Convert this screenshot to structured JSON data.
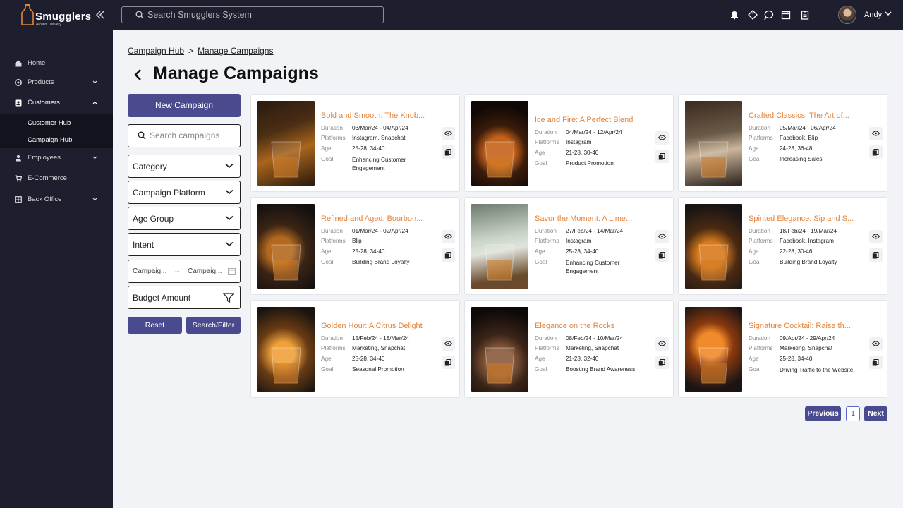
{
  "app": {
    "brand": "Smugglers",
    "brand_sub": "Alcohol Delivery",
    "search_placeholder": "Search Smugglers System",
    "user_name": "Andy"
  },
  "top_icons": [
    "bell-icon",
    "tag-icon",
    "chat-icon",
    "calendar-icon",
    "clipboard-icon"
  ],
  "sidebar": {
    "items": [
      {
        "label": "Home",
        "icon": "home-icon"
      },
      {
        "label": "Products",
        "icon": "products-icon"
      },
      {
        "label": "Customers",
        "icon": "customers-icon"
      },
      {
        "label": "Employees",
        "icon": "employees-icon"
      },
      {
        "label": "E-Commerce",
        "icon": "ecommerce-icon"
      },
      {
        "label": "Back Office",
        "icon": "back-office-icon"
      }
    ],
    "sub_items": [
      {
        "label": "Customer Hub"
      },
      {
        "label": "Campaign Hub"
      }
    ]
  },
  "breadcrumb": [
    "Campaign Hub",
    "Manage Campaigns"
  ],
  "page_title": "Manage Campaigns",
  "filters": {
    "new_campaign": "New Campaign",
    "search_placeholder": "Search campaigns",
    "category": "Category",
    "platform": "Campaign Platform",
    "age_group": "Age Group",
    "intent": "Intent",
    "date_start": "Campaig...",
    "date_end": "Campaig...",
    "budget": "Budget Amount",
    "reset": "Reset",
    "search_filter": "Search/Filter"
  },
  "card_labels": {
    "duration": "Duration",
    "platforms": "Platforms",
    "age": "Age",
    "goal": "Goal"
  },
  "campaigns": [
    {
      "title": "Bold and Smooth: The Knob...",
      "duration": "03/Mar/24 - 04/Apr/24",
      "platforms": "Instagram, Snapchat",
      "age": "25-28, 34-40",
      "goal": "Enhancing Customer Engagement"
    },
    {
      "title": "Ice and Fire: A Perfect Blend",
      "duration": "04/Mar/24 - 12/Apr/24",
      "platforms": "Instagram",
      "age": "21-28, 30-40",
      "goal": "Product Promotion"
    },
    {
      "title": "Crafted Classics: The Art of...",
      "duration": "05/Mar/24 - 06/Apr/24",
      "platforms": "Facebook, Blip",
      "age": "24-28, 36-48",
      "goal": "Increasing Sales"
    },
    {
      "title": "Refined and Aged: Bourbon...",
      "duration": "01/Mar/24 - 02/Apr/24",
      "platforms": "Blip",
      "age": "25-28, 34-40",
      "goal": "Building Brand Loyalty"
    },
    {
      "title": "Savor the Moment: A Lime...",
      "duration": "27/Feb/24 - 14/Mar/24",
      "platforms": "Instagram",
      "age": "25-28, 34-40",
      "goal": "Enhancing Customer Engagement"
    },
    {
      "title": "Spirited Elegance: Sip and S...",
      "duration": "18/Feb/24 - 19/Mar/24",
      "platforms": "Facebook, Instagram",
      "age": "22-28, 30-46",
      "goal": "Building Brand Loyalty"
    },
    {
      "title": "Golden Hour: A Citrus Delight",
      "duration": "15/Feb/24 - 18/Mar/24",
      "platforms": "Marketing, Snapchat",
      "age": "25-28, 34-40",
      "goal": "Seasonal Promotion"
    },
    {
      "title": "Elegance on the Rocks",
      "duration": "08/Feb/24 - 10/Mar/24",
      "platforms": "Marketing, Snapchat",
      "age": "21-28, 32-40",
      "goal": "Boosting Brand Awareness"
    },
    {
      "title": "Signature Cocktail: Raise th...",
      "duration": "09/Apr/24 - 29/Apr/24",
      "platforms": "Marketing, Snapchat",
      "age": "25-28, 34-40",
      "goal": "Driving Traffic to the Website"
    }
  ],
  "pagination": {
    "previous": "Previous",
    "current": "1",
    "next": "Next"
  }
}
